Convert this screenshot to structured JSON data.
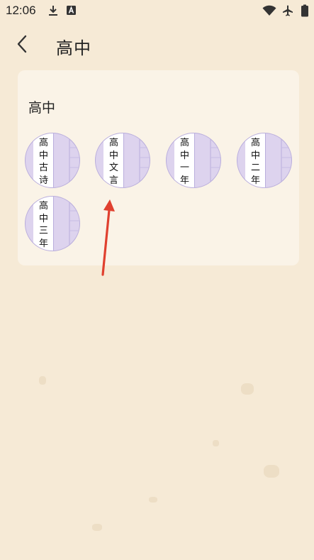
{
  "status_bar": {
    "time": "12:06",
    "icons": [
      "download-icon",
      "a-badge-icon",
      "wifi-icon",
      "airplane-icon",
      "battery-icon"
    ]
  },
  "header": {
    "title": "高中",
    "back_icon": "chevron-left-icon"
  },
  "section": {
    "title": "高中",
    "books": [
      {
        "chars": [
          "高",
          "中",
          "古",
          "诗"
        ]
      },
      {
        "chars": [
          "高",
          "中",
          "文",
          "言"
        ]
      },
      {
        "chars": [
          "高",
          "中",
          "一",
          "年"
        ]
      },
      {
        "chars": [
          "高",
          "中",
          "二",
          "年"
        ]
      },
      {
        "chars": [
          "高",
          "中",
          "三",
          "年"
        ]
      }
    ]
  },
  "colors": {
    "background": "#f6ead6",
    "card": "#faf3e7",
    "book_cover": "#ddd3ee",
    "annotation_arrow": "#e0402f"
  }
}
